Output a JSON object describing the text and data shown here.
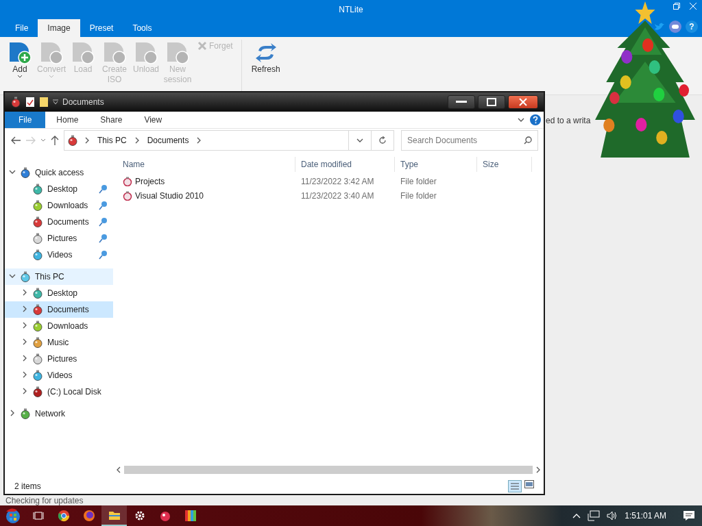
{
  "app": {
    "title": "NTLite",
    "tabs": [
      {
        "label": "File",
        "selected": false
      },
      {
        "label": "Image",
        "selected": true
      },
      {
        "label": "Preset",
        "selected": false
      },
      {
        "label": "Tools",
        "selected": false
      }
    ],
    "help": "?",
    "ribbon": [
      {
        "label": "Add",
        "kind": "large",
        "disabled": false,
        "dropdown": true
      },
      {
        "label": "Convert",
        "kind": "large",
        "disabled": true,
        "dropdown": true
      },
      {
        "label": "Load",
        "kind": "large",
        "disabled": true,
        "dropdown": false
      },
      {
        "label": "Create ISO",
        "kind": "large",
        "disabled": true,
        "dropdown": false
      },
      {
        "label": "Unload",
        "kind": "large",
        "disabled": true,
        "dropdown": false
      },
      {
        "label": "New session",
        "kind": "large",
        "disabled": true,
        "dropdown": false
      },
      {
        "label": "Forget",
        "kind": "small",
        "disabled": true
      },
      {
        "label": "Refresh",
        "kind": "refresh",
        "disabled": false
      }
    ],
    "notice": "ed to a writa",
    "status": "Checking for updates"
  },
  "explorer": {
    "title": "Documents",
    "tabs": [
      {
        "label": "File",
        "selected": true
      },
      {
        "label": "Home",
        "selected": false
      },
      {
        "label": "Share",
        "selected": false
      },
      {
        "label": "View",
        "selected": false
      }
    ],
    "breadcrumb": [
      "This PC",
      "Documents"
    ],
    "search": {
      "placeholder": "Search Documents"
    },
    "columns": [
      "Name",
      "Date modified",
      "Type",
      "Size"
    ],
    "rows": [
      {
        "name": "Projects",
        "date": "11/23/2022 3:42 AM",
        "type": "File folder"
      },
      {
        "name": "Visual Studio 2010",
        "date": "11/23/2022 3:40 AM",
        "type": "File folder"
      }
    ],
    "nav": [
      {
        "label": "Quick access",
        "expanded": true,
        "selected": false,
        "hovered": false,
        "color": "#2f7fd8",
        "children": [
          {
            "label": "Desktop",
            "pinned": true,
            "selected": false,
            "color": "#3fb8a8"
          },
          {
            "label": "Downloads",
            "pinned": true,
            "selected": false,
            "color": "#9acd32"
          },
          {
            "label": "Documents",
            "pinned": true,
            "selected": false,
            "color": "#d83a3a"
          },
          {
            "label": "Pictures",
            "pinned": true,
            "selected": false,
            "color": "#d8d8d8"
          },
          {
            "label": "Videos",
            "pinned": true,
            "selected": false,
            "color": "#3fb4e0"
          }
        ]
      },
      {
        "label": "This PC",
        "expanded": true,
        "selected": false,
        "hovered": true,
        "color": "#5ec8e8",
        "children": [
          {
            "label": "Desktop",
            "expanded": false,
            "selected": false,
            "color": "#3fb8a8"
          },
          {
            "label": "Documents",
            "expanded": false,
            "selected": true,
            "color": "#d83a3a"
          },
          {
            "label": "Downloads",
            "expanded": false,
            "selected": false,
            "color": "#9acd32"
          },
          {
            "label": "Music",
            "expanded": false,
            "selected": false,
            "color": "#e0a040"
          },
          {
            "label": "Pictures",
            "expanded": false,
            "selected": false,
            "color": "#d8d8d8"
          },
          {
            "label": "Videos",
            "expanded": false,
            "selected": false,
            "color": "#3fb4e0"
          },
          {
            "label": "(C:) Local Disk",
            "expanded": false,
            "selected": false,
            "color": "#b02020"
          }
        ]
      },
      {
        "label": "Network",
        "expanded": false,
        "selected": false,
        "hovered": false,
        "color": "#58b048"
      }
    ],
    "status": "2 items"
  },
  "taskbar": {
    "time": "1:51:01 AM"
  }
}
